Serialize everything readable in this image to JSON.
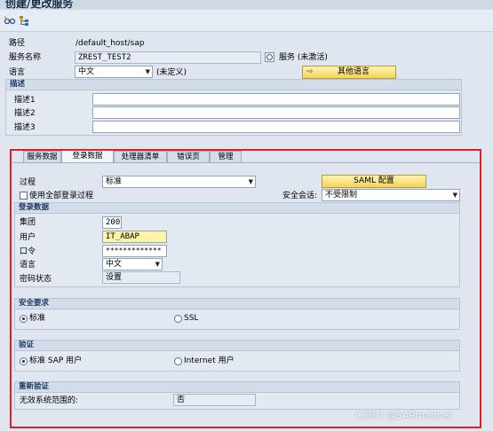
{
  "window": {
    "title": "创建/更改服务"
  },
  "toolbar": {
    "icons": [
      "glasses-icon",
      "hierarchy-icon"
    ]
  },
  "header": {
    "path_label": "路径",
    "path_value": "/default_host/sap",
    "service_name_label": "服务名称",
    "service_name_value": "ZREST_TEST2",
    "service_status": "服务 (未激活)",
    "language_label": "语言",
    "language_value": "中文",
    "language_note": "(未定义)",
    "other_languages_button": "其他语言"
  },
  "description": {
    "title": "描述",
    "rows": [
      {
        "label": "描述1",
        "value": ""
      },
      {
        "label": "描述2",
        "value": ""
      },
      {
        "label": "描述3",
        "value": ""
      }
    ]
  },
  "tabs": [
    {
      "label": "服务数据",
      "active": false
    },
    {
      "label": "登录数据",
      "active": true
    },
    {
      "label": "处理器清单",
      "active": false
    },
    {
      "label": "错误页",
      "active": false
    },
    {
      "label": "管理",
      "active": false
    }
  ],
  "logon": {
    "procedure_label": "过程",
    "procedure_value": "标准",
    "saml_button": "SAML 配置",
    "use_all_label": "使用全部登录过程",
    "use_all_checked": false,
    "secure_session_label": "安全会话:",
    "secure_session_value": "不受限制",
    "data_group": {
      "title": "登录数据",
      "client_label": "集团",
      "client_value": "200",
      "user_label": "用户",
      "user_value": "IT_ABAP",
      "password_label": "口令",
      "password_value": "*************",
      "language_label": "语言",
      "language_value": "中文",
      "pw_status_label": "密码状态",
      "pw_status_value": "设置"
    },
    "security_group": {
      "title": "安全要求",
      "options": [
        {
          "label": "标准",
          "selected": true
        },
        {
          "label": "SSL",
          "selected": false
        }
      ]
    },
    "auth_group": {
      "title": "验证",
      "options": [
        {
          "label": "标准 SAP 用户",
          "selected": true
        },
        {
          "label": "Internet 用户",
          "selected": false
        }
      ]
    },
    "reauth_group": {
      "title": "重新验证",
      "invalid_scope_label": "无效系统范围的:",
      "invalid_scope_value": "否"
    }
  },
  "watermark": "CSDN @SAPmatinal"
}
